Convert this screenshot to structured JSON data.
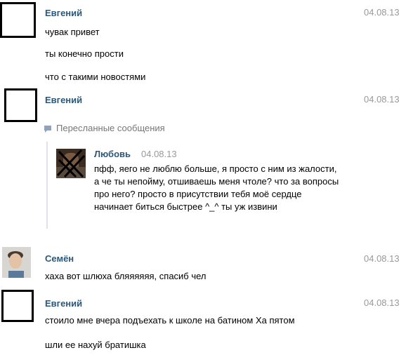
{
  "messages": [
    {
      "sender": "Евгений",
      "date": "04.08.13",
      "lines": [
        "чувак привет",
        "ты конечно прости",
        "что с такими новостями"
      ]
    },
    {
      "sender": "Евгений",
      "date": "04.08.13",
      "forwarded": {
        "header": "Пересланные сообщения",
        "sender": "Любовь",
        "date": "04.08.13",
        "text": "пфф, яего не люблю больше, я просто с ним из жалости, а че ты непойму, отшиваешь меня чтоле? что за вопросы про него? просто в присутствии тебя моё сердце начинает биться быстрее ^_^ ты уж извини"
      }
    },
    {
      "sender": "Семён",
      "date": "04.08.13",
      "lines": [
        "хаха вот шлюха бляяяяяя, спасиб чел"
      ]
    },
    {
      "sender": "Евгений",
      "date": "04.08.13",
      "lines": [
        "стоило мне вчера подъехать к школе на батином Ха пятом",
        "шли ее нахуй братишка"
      ]
    }
  ]
}
